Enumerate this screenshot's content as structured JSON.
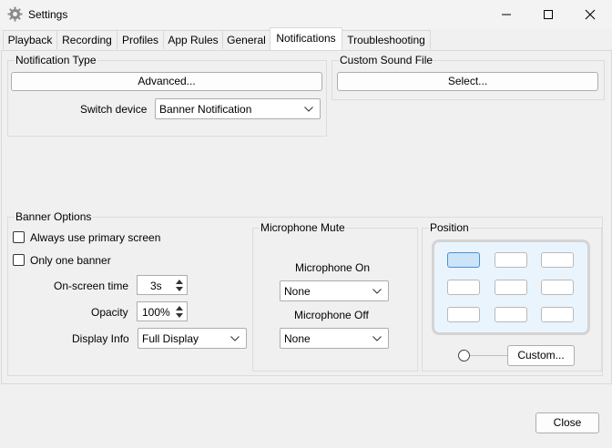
{
  "window": {
    "title": "Settings"
  },
  "tabs": [
    {
      "label": "Playback"
    },
    {
      "label": "Recording"
    },
    {
      "label": "Profiles"
    },
    {
      "label": "App Rules"
    },
    {
      "label": "General"
    },
    {
      "label": "Notifications"
    },
    {
      "label": "Troubleshooting"
    }
  ],
  "active_tab": "Notifications",
  "notification_type": {
    "group_label": "Notification Type",
    "advanced_button": "Advanced...",
    "switch_device_label": "Switch device",
    "switch_device_value": "Banner Notification"
  },
  "custom_sound": {
    "group_label": "Custom Sound File",
    "select_button": "Select..."
  },
  "banner_options": {
    "group_label": "Banner Options",
    "always_primary_label": "Always use primary screen",
    "always_primary_checked": false,
    "only_one_label": "Only one banner",
    "only_one_checked": false,
    "onscreen_label": "On-screen time",
    "onscreen_value": "3s",
    "opacity_label": "Opacity",
    "opacity_value": "100%",
    "display_info_label": "Display Info",
    "display_info_value": "Full Display"
  },
  "mic_mute": {
    "group_label": "Microphone Mute",
    "mic_on_label": "Microphone On",
    "mic_on_value": "None",
    "mic_off_label": "Microphone Off",
    "mic_off_value": "None"
  },
  "position": {
    "group_label": "Position",
    "selected_cell": 0,
    "custom_radio_checked": false,
    "custom_button": "Custom..."
  },
  "close_button": "Close"
}
